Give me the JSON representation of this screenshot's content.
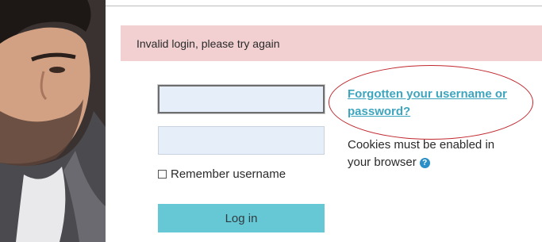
{
  "alert": {
    "message": "Invalid login, please try again"
  },
  "form": {
    "username_value": "",
    "password_value": "",
    "remember_label": "Remember username",
    "login_label": "Log in"
  },
  "links": {
    "forgotten_line1": "Forgotten your username or",
    "forgotten_line2": "password?"
  },
  "info": {
    "cookies_line1": "Cookies must be enabled in",
    "cookies_line2": "your browser",
    "help_icon": "question-circle-icon"
  },
  "colors": {
    "alert_bg": "#f2d0d1",
    "link": "#3ea5bf",
    "button_bg": "#66c8d5",
    "input_bg": "#e6eefa",
    "annotation": "#c0272d"
  }
}
